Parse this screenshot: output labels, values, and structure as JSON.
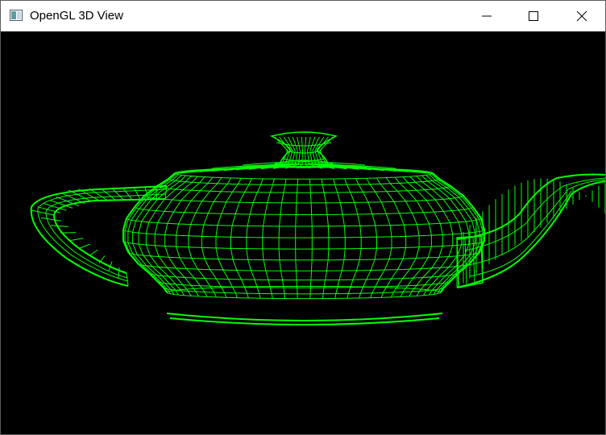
{
  "window": {
    "title": "OpenGL 3D View",
    "icon": "application-icon",
    "controls": [
      "minimize-icon",
      "maximize-icon",
      "close-icon"
    ]
  },
  "viewport": {
    "background_color": "#000000",
    "model": "teapot",
    "render_mode": "wireframe",
    "wire_color": "#00ff00"
  }
}
